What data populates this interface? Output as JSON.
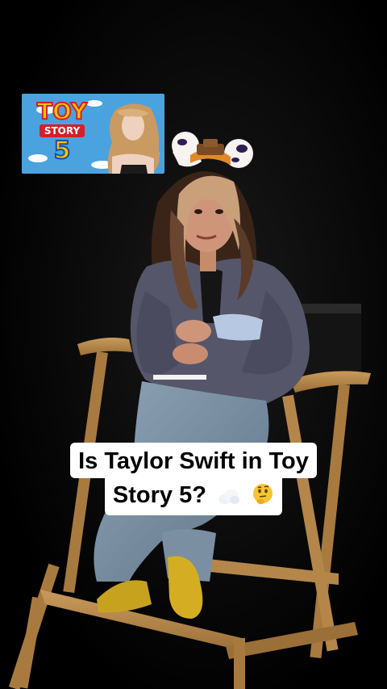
{
  "inset": {
    "logo_line1": "TOY",
    "logo_line2": "STORY",
    "logo_line3": "5"
  },
  "caption": {
    "line1": "Is Taylor Swift in Toy",
    "line2": "Story 5?"
  },
  "icons": [
    "cloud-emoji-icon",
    "thinking-face-emoji-icon"
  ],
  "colors": {
    "background": "#000000",
    "caption_bg": "#ffffff",
    "caption_text": "#000000",
    "logo_yellow": "#f5c400",
    "logo_red": "#d3202a",
    "sky_blue": "#4aa3de"
  }
}
